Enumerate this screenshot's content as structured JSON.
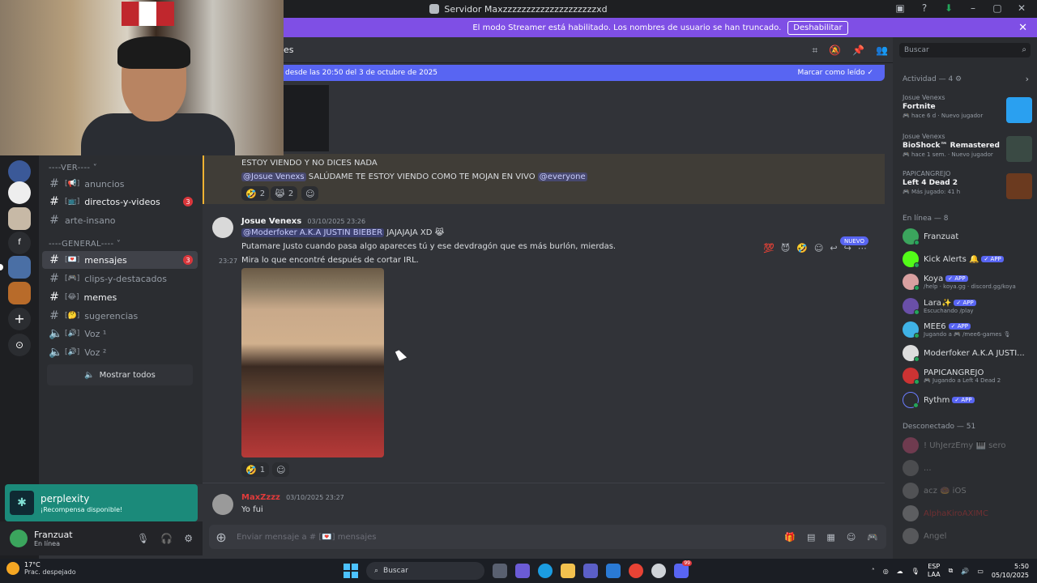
{
  "window": {
    "title": "Servidor Maxzzzzzzzzzzzzzzzzzzzzxd"
  },
  "banner": {
    "text": "El modo Streamer está habilitado. Los nombres de usuario se han truncado.",
    "button": "Deshabilitar"
  },
  "header": {
    "title": "es"
  },
  "newbar": {
    "text": "desde las 20:50 del 3 de octubre de 2025",
    "mark": "Marcar como leído"
  },
  "channels": {
    "cat_ver": "----VER---- ˅",
    "cat_general": "----GENERAL---- ˅",
    "items": [
      {
        "name": "anuncios",
        "emoji": "[📢]"
      },
      {
        "name": "directos-y-videos",
        "emoji": "[📺]",
        "count": "3"
      },
      {
        "name": "arte-insano",
        "emoji": ""
      },
      {
        "name": "mensajes",
        "emoji": "[💌]",
        "count": "3"
      },
      {
        "name": "clips-y-destacados",
        "emoji": "[🎮]"
      },
      {
        "name": "memes",
        "emoji": "[😂]"
      },
      {
        "name": "sugerencias",
        "emoji": "[🤔]"
      },
      {
        "name": "Voz ¹",
        "emoji": "[🔊]"
      },
      {
        "name": "Voz ²",
        "emoji": "[🔊]"
      }
    ],
    "show_all": "Mostrar todos"
  },
  "messages": {
    "m1_line1": "ESTOY VIENDO Y NO DICES NADA",
    "m1_mention": "@Josue Venexs",
    "m1_text": "SALÚDAME TE ESTOY VIENDO COMO TE MOJAN EN VIVO",
    "m1_everyone": "@everyone",
    "m1_r1": "2",
    "m1_r2": "2",
    "m2_user": "Josue Venexs",
    "m2_time": "03/10/2025 23:26",
    "m2_mention": "@Moderfoker A.K.A JUSTIN BIEBER",
    "m2_text": "JAJAJAJA XD 😹",
    "m2_line2": "Putamare Justo cuando pasa algo apareces tú y ese devdragón que es más burlón, mierdas.",
    "m2_stamp": "23:27",
    "m2_line3": "Mira lo que encontré después de cortar IRL.",
    "m2_r1": "1",
    "new_tag": "NUEVO",
    "m3_user": "MaxZzzz",
    "m3_time": "03/10/2025 23:27",
    "m3_text": "Yo fui"
  },
  "composer": {
    "placeholder": "Enviar mensaje a # [💌] mensajes"
  },
  "promo": {
    "title": "perplexity",
    "sub": "¡Recompensa disponible!"
  },
  "user": {
    "name": "Franzuat",
    "status": "En línea"
  },
  "right": {
    "search": "Buscar",
    "activity_header": "Actividad — 4 ⚙",
    "activities": [
      {
        "name": "Josue Venexs",
        "game": "Fortnite",
        "meta": "🎮 hace 6 d  · Nuevo jugador"
      },
      {
        "name": "Josue Venexs",
        "game": "BioShock™ Remastered",
        "meta": "🎮 hace 1 sem. · Nuevo jugador"
      },
      {
        "name": "PAPICANGREJO",
        "game": "Left 4 Dead 2",
        "meta": "🎮 Más jugado: 41 h"
      }
    ],
    "online_header": "En línea — 8",
    "online": [
      {
        "name": "Franzuat",
        "sub": "",
        "app": ""
      },
      {
        "name": "Kick Alerts 🔔",
        "sub": "",
        "app": "✓ APP"
      },
      {
        "name": "Koya",
        "sub": "/help · koya.gg · discord.gg/koya",
        "app": "✓ APP"
      },
      {
        "name": "Lara✨",
        "sub": "Escuchando /play",
        "app": "✓ APP"
      },
      {
        "name": "MEE6",
        "sub": "Jugando a 🎮 /mee6-games 🎙",
        "app": "✓ APP"
      },
      {
        "name": "Moderfoker A.K.A JUSTI...",
        "sub": "",
        "app": ""
      },
      {
        "name": "PAPICANGREJO",
        "sub": "🎮 Jugando a Left 4 Dead 2",
        "app": ""
      },
      {
        "name": "Rythm",
        "sub": "",
        "app": "✓ APP"
      }
    ],
    "offline_header": "Desconectado — 51",
    "offline": [
      {
        "name": "! UhJerzEmy 🎹 sero"
      },
      {
        "name": "..."
      },
      {
        "name": "acz 🍩 iOS"
      },
      {
        "name": "AlphaKiroAXIMC"
      },
      {
        "name": "Angel"
      }
    ]
  },
  "taskbar": {
    "temp": "17°C",
    "weather": "Prac. despejado",
    "search": "Buscar",
    "lang": "ESP",
    "lang2": "LAA",
    "time": "5:50",
    "date": "05/10/2025",
    "discord_badge": "99"
  }
}
